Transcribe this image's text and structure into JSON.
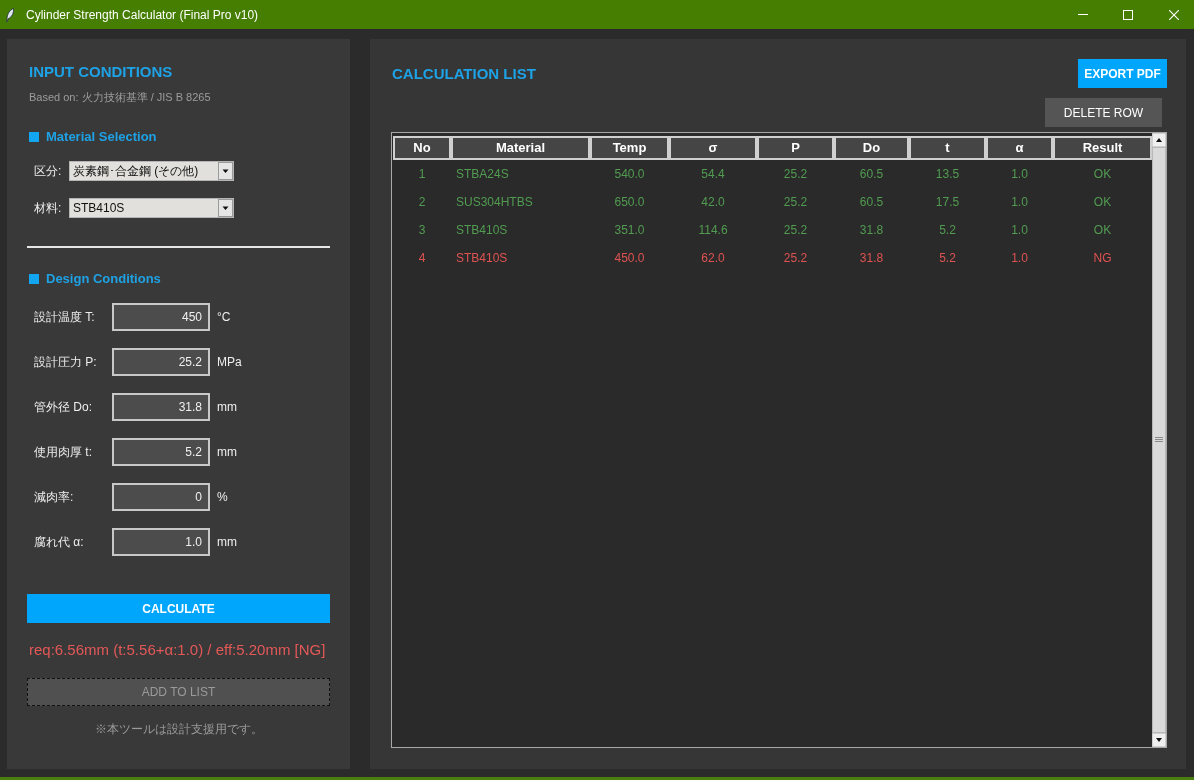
{
  "window": {
    "title": "Cylinder Strength Calculator (Final Pro v10)"
  },
  "input_panel": {
    "title": "INPUT CONDITIONS",
    "basis": "Based on: 火力技術基準 / JIS B 8265",
    "material_section": {
      "title": "Material Selection",
      "dropdowns": [
        {
          "label": "区分:",
          "value": "炭素鋼･合金鋼 (その他)"
        },
        {
          "label": "材料:",
          "value": "STB410S"
        }
      ]
    },
    "design_section": {
      "title": "Design Conditions",
      "fields": [
        {
          "label": "設計温度 T:",
          "value": "450",
          "unit": "°C"
        },
        {
          "label": "設計圧力 P:",
          "value": "25.2",
          "unit": "MPa"
        },
        {
          "label": "管外径 Do:",
          "value": "31.8",
          "unit": "mm"
        },
        {
          "label": "使用肉厚 t:",
          "value": "5.2",
          "unit": "mm"
        },
        {
          "label": "減肉率:",
          "value": "0",
          "unit": "%"
        },
        {
          "label": "腐れ代 α:",
          "value": "1.0",
          "unit": "mm"
        }
      ]
    },
    "calculate_button": "CALCULATE",
    "result": "req:6.56mm (t:5.56+α:1.0) / eff:5.20mm [NG]",
    "add_button": {
      "label": "ADD TO LIST",
      "disabled": true
    },
    "note": "※本ツールは設計支援用です。"
  },
  "list_panel": {
    "title": "CALCULATION LIST",
    "export_button": "EXPORT PDF",
    "delete_button": "DELETE ROW",
    "table": {
      "columns": [
        "No",
        "Material",
        "Temp",
        "σ",
        "P",
        "Do",
        "t",
        "α",
        "Result"
      ],
      "rows": [
        {
          "cells": [
            "1",
            "STBA24S",
            "540.0",
            "54.4",
            "25.2",
            "60.5",
            "13.5",
            "1.0",
            "OK"
          ],
          "color": "#519c51"
        },
        {
          "cells": [
            "2",
            "SUS304HTBS",
            "650.0",
            "42.0",
            "25.2",
            "60.5",
            "17.5",
            "1.0",
            "OK"
          ],
          "color": "#519c51"
        },
        {
          "cells": [
            "3",
            "STB410S",
            "351.0",
            "114.6",
            "25.2",
            "31.8",
            "5.2",
            "1.0",
            "OK"
          ],
          "color": "#519c51"
        },
        {
          "cells": [
            "4",
            "STB410S",
            "450.0",
            "62.0",
            "25.2",
            "31.8",
            "5.2",
            "1.0",
            "NG"
          ],
          "color": "#e05252"
        }
      ]
    }
  }
}
